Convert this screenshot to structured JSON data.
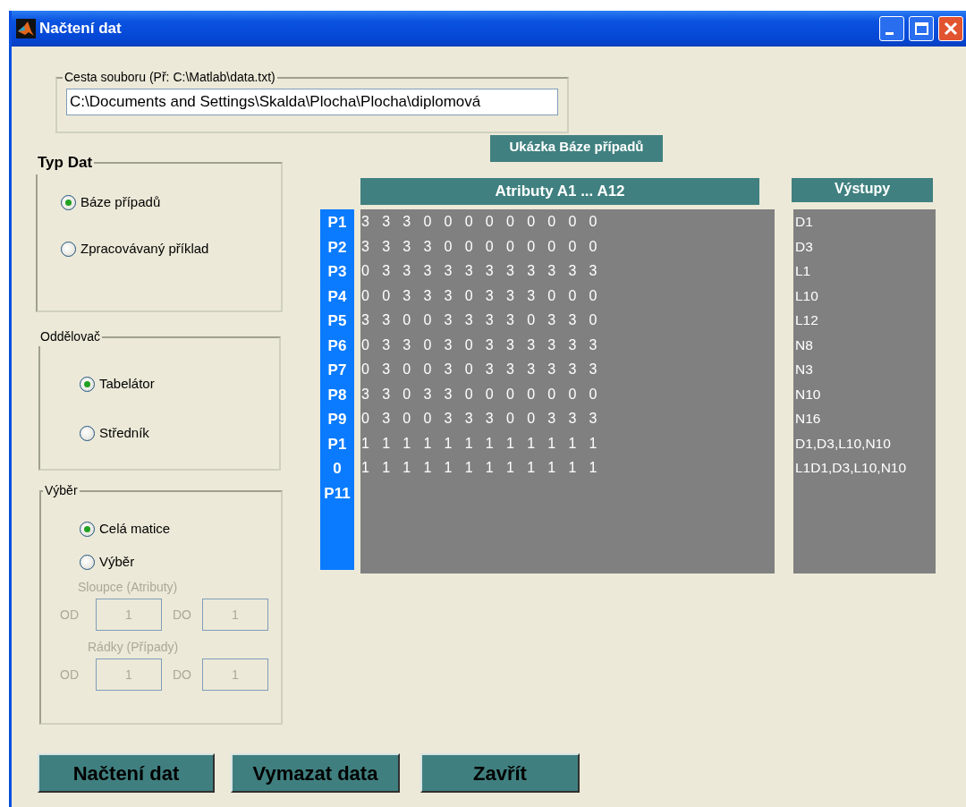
{
  "window": {
    "title": "Načtení dat"
  },
  "path_group": {
    "label": "Cesta souboru (Př: C:\\Matlab\\data.txt)",
    "value": "C:\\Documents and Settings\\Skalda\\Plocha\\Plocha\\diplomová"
  },
  "data_type": {
    "title": "Typ Dat",
    "options": [
      {
        "label": "Báze případů",
        "selected": true
      },
      {
        "label": "Zpracovávaný příklad",
        "selected": false
      }
    ]
  },
  "separator": {
    "title": "Oddělovač",
    "options": [
      {
        "label": "Tabelátor",
        "selected": true
      },
      {
        "label": "Středník",
        "selected": false
      }
    ]
  },
  "selection": {
    "title": "Výběr",
    "options": [
      {
        "label": "Celá matice",
        "selected": true
      },
      {
        "label": "Výběr",
        "selected": false
      }
    ],
    "disabled": true,
    "groups": [
      {
        "label": "Sloupce (Atributy)",
        "from_label": "OD",
        "from_value": "1",
        "to_label": "DO",
        "to_value": "1"
      },
      {
        "label": "Rádky (Případy)",
        "from_label": "OD",
        "from_value": "1",
        "to_label": "DO",
        "to_value": "1"
      }
    ]
  },
  "preview": {
    "title": "Ukázka Báze případů",
    "attributes_header": "Atributy A1 ... A12",
    "outputs_header": "Výstupy",
    "row_labels": [
      "P1",
      "P2",
      "P3",
      "P4",
      "P5",
      "P6",
      "P7",
      "P8",
      "P9",
      "P1",
      "0",
      "P11"
    ],
    "rows": [
      "3 3 3 0 0 0 0 0 0 0 0 0",
      "3 3 3 3 0 0 0 0 0 0 0 0",
      "0 3 3 3 3 3 3 3 3 3 3 3",
      "0 0 3 3 3 0 3 3 3 0 0 0",
      "3 3 0 0 3 3 3 3 0 3 3 0",
      "0 3 3 0 3 0 3 3 3 3 3 3",
      "0 3 0 0 3 0 3 3 3 3 3 3",
      "3 3 0 3 3 0 0 0 0 0 0 0",
      "0 3 0 0 3 3 3 0 0 3 3 3",
      "1 1 1 1 1 1 1 1 1 1 1 1",
      "1 1 1 1 1 1 1 1 1 1 1 1"
    ],
    "outputs": [
      "D1",
      "D3",
      "L1",
      "L10",
      "L12",
      "N8",
      "N3",
      "N10",
      "N16",
      "D1,D3,L10,N10",
      "L1D1,D3,L10,N10"
    ]
  },
  "buttons": [
    "Načtení dat",
    "Vymazat data",
    "Zavřít"
  ]
}
